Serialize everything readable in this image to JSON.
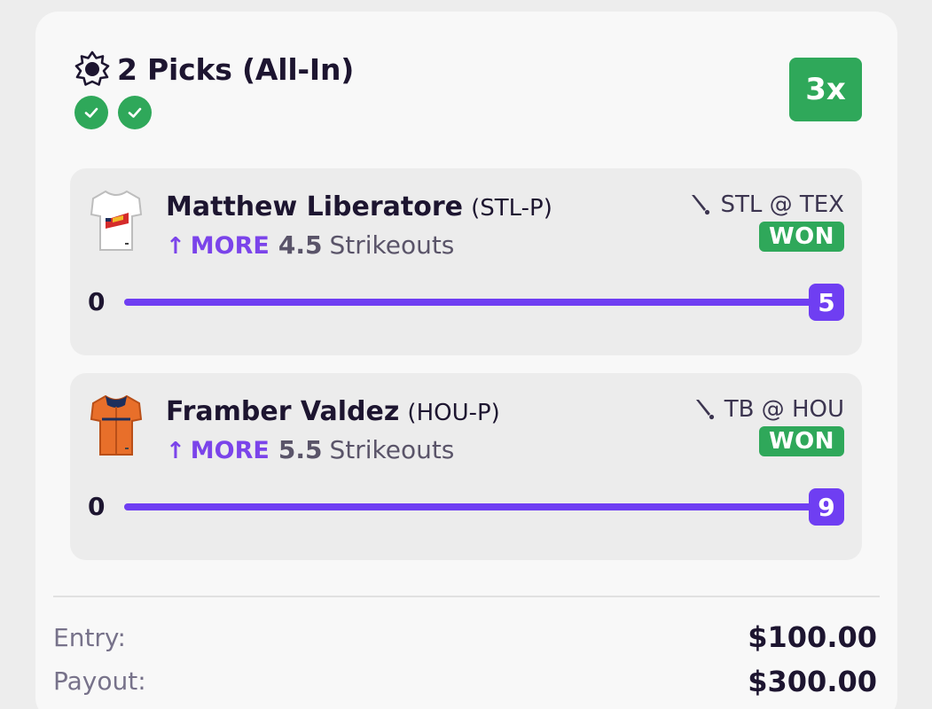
{
  "header": {
    "title": "2 Picks (All-In)",
    "multiplier": "3x",
    "results": [
      "won",
      "won"
    ]
  },
  "picks": [
    {
      "player": "Matthew Liberatore",
      "team": "(STL-P)",
      "direction": "MORE",
      "line": "4.5",
      "stat": "Strikeouts",
      "matchup": "STL @ TEX",
      "status": "WON",
      "range_start": "0",
      "actual": "5",
      "progress_fraction": 1.0,
      "jersey_colors": {
        "body": "#ffffff",
        "accent": "#d42b2b",
        "secondary": "#f2b928"
      }
    },
    {
      "player": "Framber Valdez",
      "team": "(HOU-P)",
      "direction": "MORE",
      "line": "5.5",
      "stat": "Strikeouts",
      "matchup": "TB @ HOU",
      "status": "WON",
      "range_start": "0",
      "actual": "9",
      "progress_fraction": 1.0,
      "jersey_colors": {
        "body": "#e86f2a",
        "accent": "#1d2f5c"
      }
    }
  ],
  "summary": {
    "entry_label": "Entry:",
    "entry_value": "$100.00",
    "payout_label": "Payout:",
    "payout_value": "$300.00"
  },
  "colors": {
    "accent_purple": "#6f3ef2",
    "won_green": "#2fa85a",
    "icons": [
      "sun-icon",
      "check-icon",
      "bat-icon",
      "arrow-up-icon",
      "jersey-icon"
    ]
  }
}
